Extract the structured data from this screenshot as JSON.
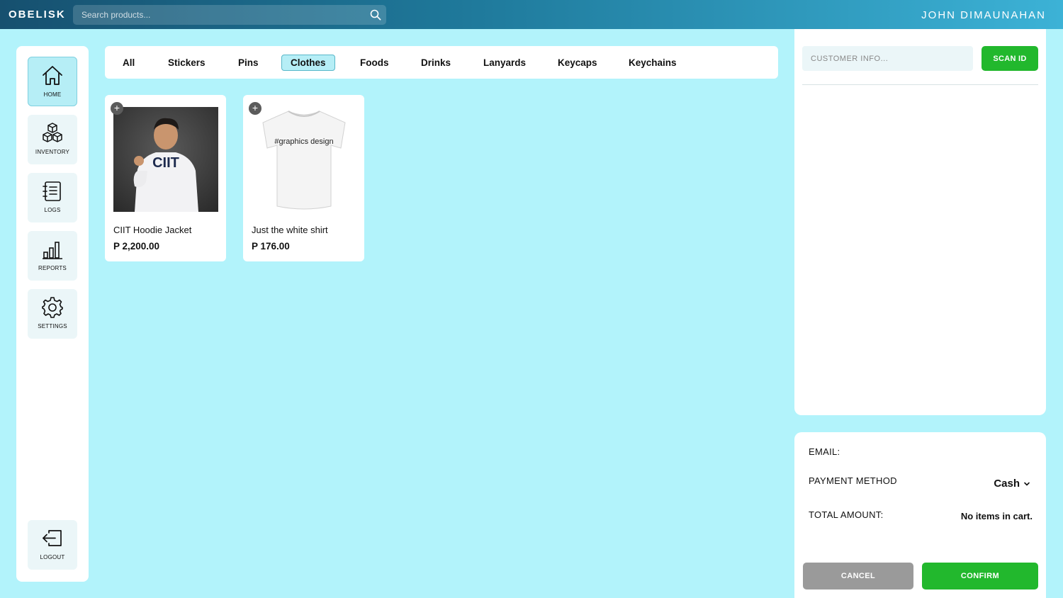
{
  "app": {
    "brand": "OBELISK",
    "search_placeholder": "Search products...",
    "user_name": "JOHN DIMAUNAHAN"
  },
  "sidebar": {
    "items": [
      {
        "label": "HOME",
        "icon": "home-icon",
        "active": true
      },
      {
        "label": "INVENTORY",
        "icon": "boxes-icon",
        "active": false
      },
      {
        "label": "LOGS",
        "icon": "notebook-icon",
        "active": false
      },
      {
        "label": "REPORTS",
        "icon": "bar-chart-icon",
        "active": false
      },
      {
        "label": "SETTINGS",
        "icon": "gear-icon",
        "active": false
      }
    ],
    "logout_label": "LOGOUT"
  },
  "categories": [
    "All",
    "Stickers",
    "Pins",
    "Clothes",
    "Foods",
    "Drinks",
    "Lanyards",
    "Keycaps",
    "Keychains"
  ],
  "active_category": "Clothes",
  "products": [
    {
      "name": "CIIT Hoodie Jacket",
      "price": "P 2,200.00",
      "image_text": "CIIT"
    },
    {
      "name": "Just the white shirt",
      "price": "P 176.00",
      "image_text": "#graphics design"
    }
  ],
  "cart": {
    "customer_placeholder": "CUSTOMER INFO...",
    "scan_label": "SCAN ID"
  },
  "checkout": {
    "email_label": "EMAIL:",
    "payment_label": "PAYMENT METHOD",
    "payment_value": "Cash",
    "total_label": "TOTAL AMOUNT:",
    "total_value": "No items in cart.",
    "cancel_label": "CANCEL",
    "confirm_label": "CONFIRM"
  },
  "colors": {
    "background": "#b2f3fb",
    "accent_green": "#22b82d",
    "active_tab": "#b6eef6",
    "header_dark": "#16506f",
    "header_light": "#3cb2d6"
  }
}
